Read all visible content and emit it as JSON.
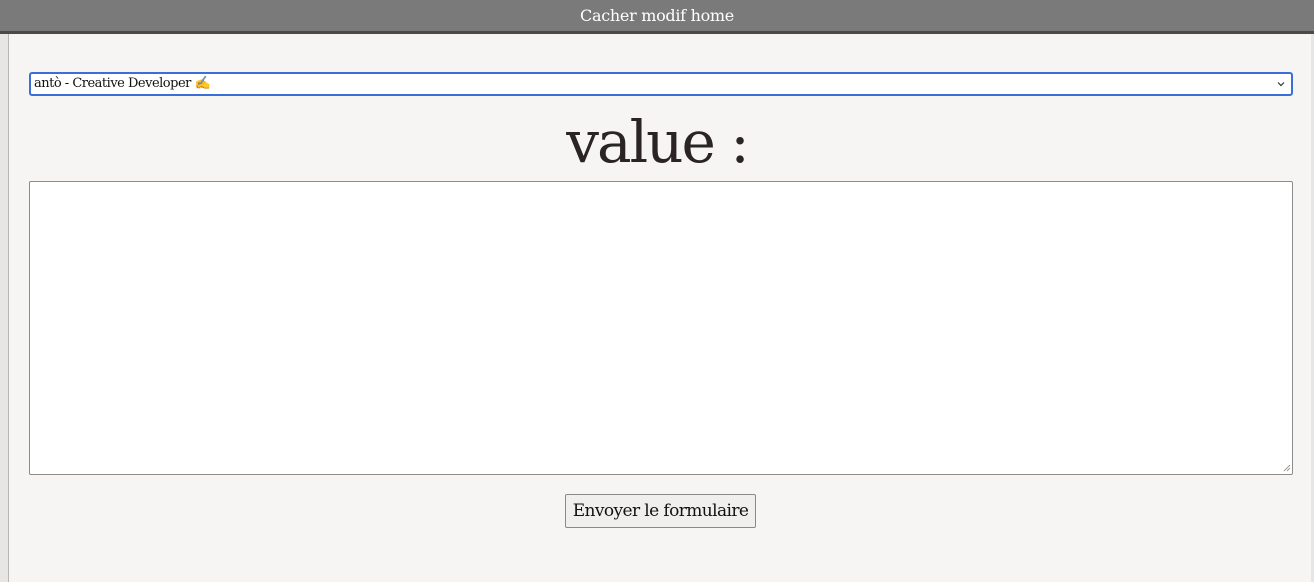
{
  "topbar": {
    "label": "Cacher modif home"
  },
  "form": {
    "select": {
      "selected_value": "antò - Creative Developer ✍"
    },
    "heading": "value :",
    "textarea": {
      "value": "",
      "placeholder": ""
    },
    "submit_label": "Envoyer le formulaire"
  },
  "icons": {
    "select_arrow": "chevron-down-icon",
    "textarea_grip": "resize-grip-icon"
  },
  "colors": {
    "topbar_bg": "#7a7a7a",
    "select_focus_border": "#3a6fd8",
    "page_bg": "#f7f5f4",
    "heading_text": "#2a2424"
  }
}
